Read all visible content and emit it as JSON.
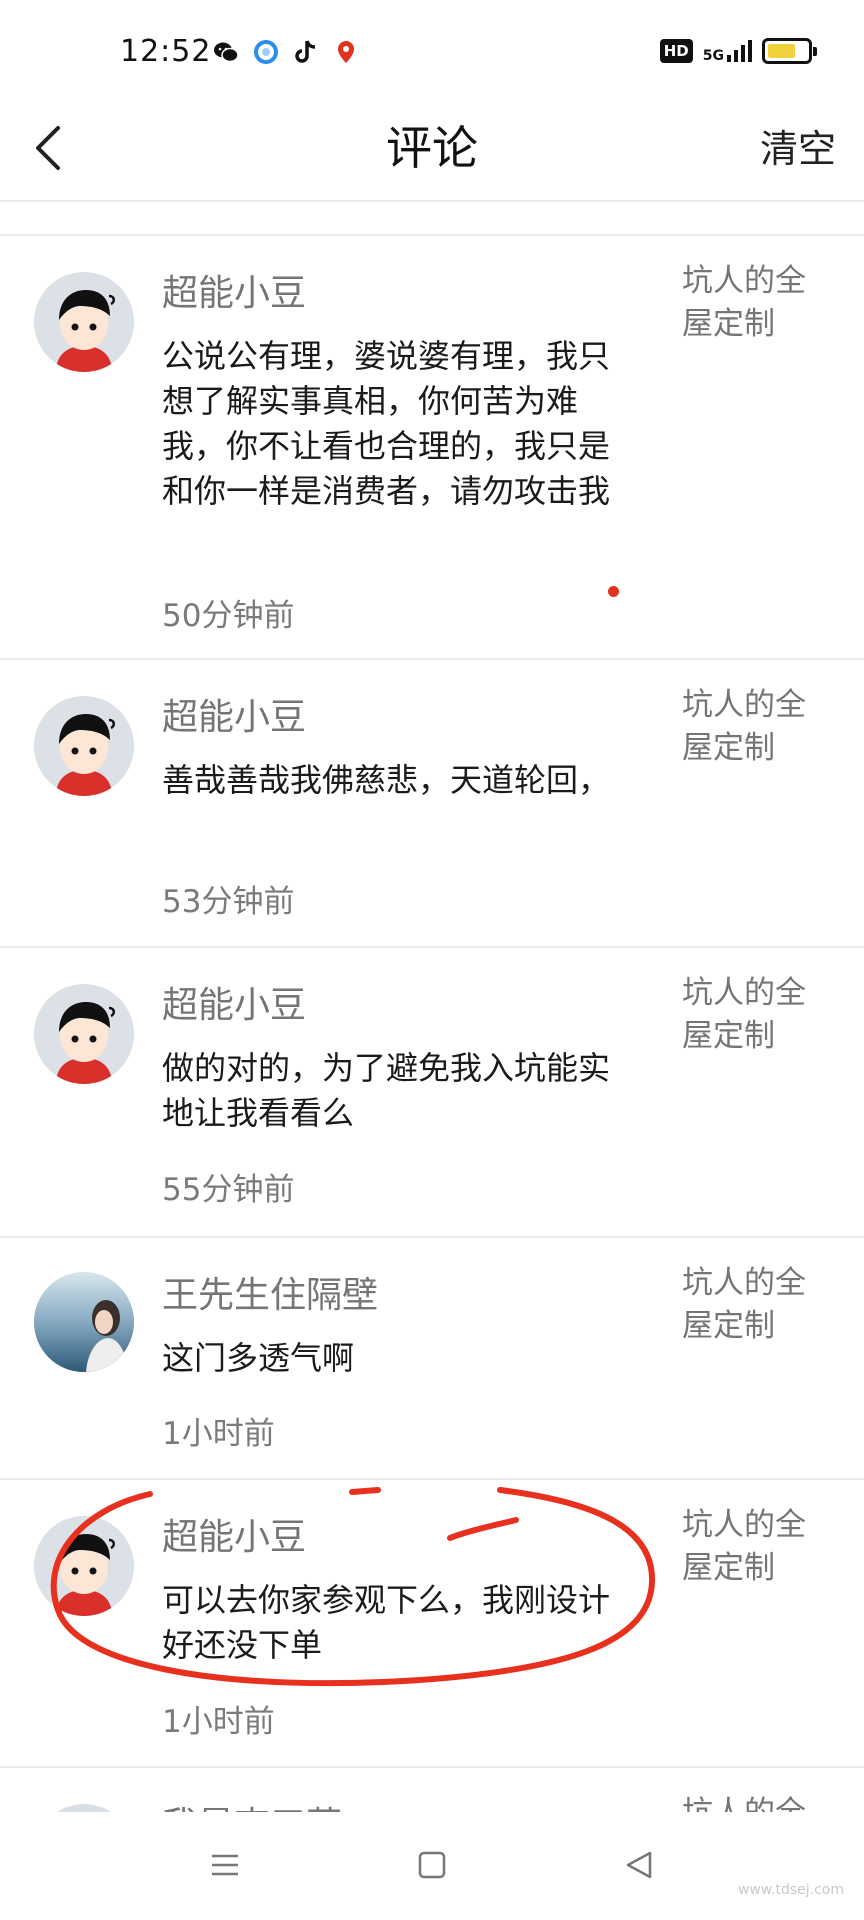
{
  "status": {
    "time": "12:52",
    "network": "5G",
    "hd": "HD",
    "app_icons": [
      "wechat-icon",
      "qq-browser-icon",
      "tiktok-icon",
      "map-pin-icon"
    ]
  },
  "header": {
    "title": "评论",
    "clear_label": "清空"
  },
  "comments": [
    {
      "user": "超能小豆",
      "avatar": "cartoon-boy",
      "text": "公说公有理，婆说婆有理，我只想了解实事真相，你何苦为难我，你不让看也合理的，我只是和你一样是消费者，请勿攻击我",
      "time": "50分钟前",
      "ref": "坑人的全屋定制"
    },
    {
      "user": "超能小豆",
      "avatar": "cartoon-boy",
      "text": "善哉善哉我佛慈悲，天道轮回，",
      "time": "53分钟前",
      "ref": "坑人的全屋定制"
    },
    {
      "user": "超能小豆",
      "avatar": "cartoon-boy",
      "text": "做的对的，为了避免我入坑能实地让我看看么",
      "time": "55分钟前",
      "ref": "坑人的全屋定制"
    },
    {
      "user": "王先生住隔壁",
      "avatar": "photo",
      "text": "这门多透气啊",
      "time": "1小时前",
      "ref": "坑人的全屋定制"
    },
    {
      "user": "超能小豆",
      "avatar": "cartoon-boy",
      "text": "可以去你家参观下么，我刚设计好还没下单",
      "time": "1小时前",
      "ref": "坑人的全屋定制"
    },
    {
      "user": "我是李三草",
      "avatar": "cartoon-boy",
      "text": "",
      "time": "",
      "ref": "坑人的全"
    }
  ],
  "watermark": "www.tdsej.com",
  "colors": {
    "accent_red": "#e0321e",
    "battery": "#f2d23c",
    "annotation": "#e8301f"
  }
}
